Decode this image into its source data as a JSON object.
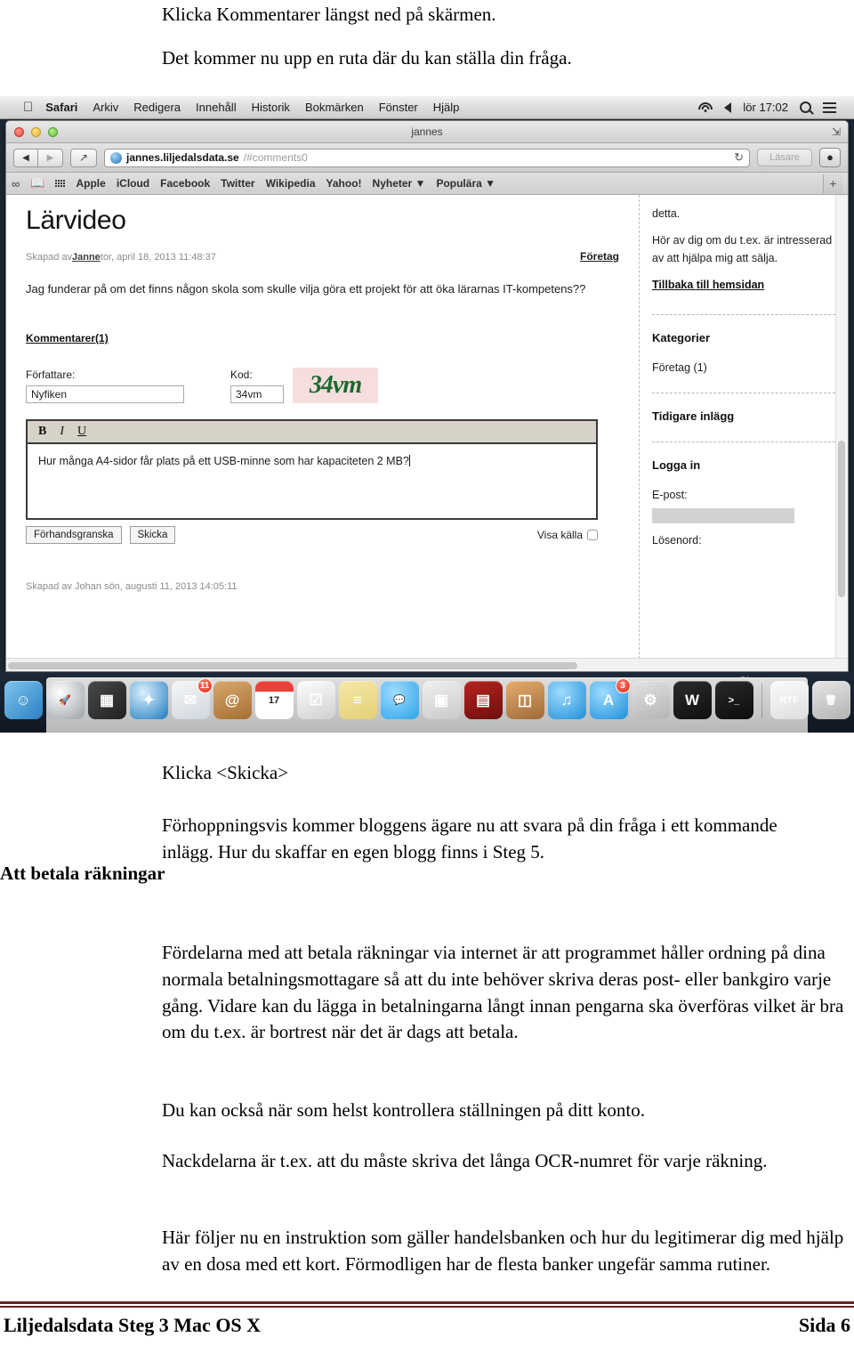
{
  "document": {
    "intro_line_1": "Klicka Kommentarer längst ned på skärmen.",
    "intro_line_2": "Det kommer nu upp en ruta där du kan ställa din fråga.",
    "klicka_skicka": "Klicka <Skicka>",
    "forhoppningsvis": "Förhoppningsvis kommer bloggens ägare nu att svara på din fråga i ett kommande inlägg. Hur du skaffar en egen blogg finns i Steg 5.",
    "heading_att_betala": "Att betala räkningar",
    "fordelarna": "Fördelarna med att betala räkningar via internet är att programmet håller ordning på dina normala betalningsmottagare så att du inte behöver skriva deras post- eller bankgiro varje gång. Vidare kan du lägga in betalningarna långt innan pengarna ska överföras vilket är bra om du t.ex. är bortrest när det är dags att betala.",
    "du_kan_ocksa": "Du kan också när som helst kontrollera ställningen på ditt konto.",
    "nackdelarna": "Nackdelarna är t.ex. att du måste skriva det långa OCR-numret för varje räkning.",
    "har_foljer": "Här följer nu en instruktion som gäller handelsbanken och hur du legitimerar dig med hjälp av en dosa med ett kort. Förmodligen har de flesta banker ungefär samma rutiner.",
    "footer_left": "Liljedalsdata Steg 3 Mac OS X",
    "footer_right": "Sida 6",
    "footer_rule_color": "#6b2020"
  },
  "screenshot": {
    "menubar": {
      "apple_icon": "apple-icon",
      "app_name": "Safari",
      "menus": [
        "Arkiv",
        "Redigera",
        "Innehåll",
        "Historik",
        "Bokmärken",
        "Fönster",
        "Hjälp"
      ],
      "wifi_icon": "wifi-icon",
      "volume_icon": "volume-icon",
      "clock": "lör 17:02",
      "spotlight_icon": "search-icon",
      "notifications_icon": "notification-list-icon"
    },
    "window": {
      "title": "jannes",
      "close_label": "close-button",
      "minimize_label": "minimize-button",
      "zoom_label": "zoom-button",
      "fullscreen_icon": "fullscreen-icon"
    },
    "toolbar": {
      "back": "◀",
      "forward": "▶",
      "share_icon": "share-icon",
      "url_strong": "jannes.liljedalsdata.se",
      "url_dim": "/#comments0",
      "reload_icon": "↻",
      "reader_label": "Läsare",
      "downloads_icon": "downloads-icon"
    },
    "bookmarks": {
      "sidebar_icon": "reading-glasses-icon",
      "book_icon": "book-icon",
      "grid_icon": "top-sites-icon",
      "items": [
        "Apple",
        "iCloud",
        "Facebook",
        "Twitter",
        "Wikipedia",
        "Yahoo!"
      ],
      "menus": [
        "Nyheter",
        "Populära"
      ],
      "new_tab_label": "+"
    },
    "page": {
      "post_title": "Lärvideo",
      "meta_prefix": "Skapad av ",
      "meta_author": "Janne",
      "meta_date": " tor, april 18, 2013 11:48:37",
      "category_link": "Företag",
      "post_body": "Jag funderar på om det finns någon skola som skulle vilja göra ett projekt för att öka lärarnas IT-kompetens??",
      "comments_heading": "Kommentarer(1)",
      "author_label": "Författare:",
      "author_value": "Nyfiken",
      "kod_label": "Kod:",
      "kod_value": "34vm",
      "captcha_text": "34vm",
      "captcha_bg": "#f6dede",
      "captcha_fg": "#1a6b2e",
      "editor_bold": "B",
      "editor_italic": "I",
      "editor_underline": "U",
      "editor_text": "Hur många A4-sidor får plats på ett USB-minne som har kapaciteten 2 MB?",
      "preview_button": "Förhandsgranska",
      "send_button": "Skicka",
      "show_source_label": "Visa källa",
      "last_comment_meta": "Skapad av Johan sön, augusti 11, 2013 14:05:11"
    },
    "sidebar": {
      "text_top": "detta.",
      "text_hor": "Hör av dig om du t.ex. är intresserad av att hjälpa mig att sälja.",
      "back_link": "Tillbaka till hemsidan",
      "categories_heading": "Kategorier",
      "category_item": "Företag (1)",
      "earlier_heading": "Tidigare inlägg",
      "login_heading": "Logga in",
      "email_label": "E-post:",
      "password_label": "Lösenord:"
    },
    "dock": {
      "clapp_label": "Clapp",
      "items": [
        {
          "name": "finder-icon",
          "glyph": "☺",
          "bg": "linear-gradient(135deg,#7fc6f0,#2b7fc1)",
          "badge": ""
        },
        {
          "name": "launchpad-icon",
          "glyph": "🚀",
          "bg": "radial-gradient(circle at 35% 30%,#ffffff,#9aa0a6)",
          "badge": ""
        },
        {
          "name": "mission-control-icon",
          "glyph": "▦",
          "bg": "linear-gradient(135deg,#4a4a4a,#1f1f1f)",
          "badge": ""
        },
        {
          "name": "safari-icon",
          "glyph": "✦",
          "bg": "radial-gradient(circle at 35% 30%,#d9f0ff,#1f7bbd)",
          "badge": ""
        },
        {
          "name": "mail-icon",
          "glyph": "✉",
          "bg": "linear-gradient(160deg,#f6f6f6,#cfd7de)",
          "badge": "11"
        },
        {
          "name": "contacts-icon",
          "glyph": "@",
          "bg": "linear-gradient(160deg,#d9a86a,#a56f33)",
          "badge": ""
        },
        {
          "name": "calendar-icon",
          "glyph": "17",
          "bg": "linear-gradient(180deg,#e8413a 0%,#e8413a 28%,#ffffff 28%)",
          "badge": ""
        },
        {
          "name": "reminders-icon",
          "glyph": "☑",
          "bg": "linear-gradient(160deg,#fdfdfd,#d0d0d0)",
          "badge": ""
        },
        {
          "name": "notes-icon",
          "glyph": "≡",
          "bg": "linear-gradient(160deg,#f6e9a8,#e2cf76)",
          "badge": ""
        },
        {
          "name": "messages-icon",
          "glyph": "💬",
          "bg": "radial-gradient(circle at 35% 30%,#9fdcff,#2aa3e8)",
          "badge": ""
        },
        {
          "name": "facetime-icon",
          "glyph": "▣",
          "bg": "linear-gradient(160deg,#f0f0f0,#c9c9c9)",
          "badge": ""
        },
        {
          "name": "photobooth-icon",
          "glyph": "▤",
          "bg": "linear-gradient(160deg,#b6231f,#6d0f0d)",
          "badge": ""
        },
        {
          "name": "iphoto-icon",
          "glyph": "◫",
          "bg": "linear-gradient(160deg,#e8ac6c,#9c6a38)",
          "badge": ""
        },
        {
          "name": "itunes-icon",
          "glyph": "♫",
          "bg": "radial-gradient(circle at 35% 30%,#9fdcff,#1d8fd8)",
          "badge": ""
        },
        {
          "name": "app-store-icon",
          "glyph": "A",
          "bg": "radial-gradient(circle at 35% 30%,#9fdcff,#1d8fd8)",
          "badge": "3"
        },
        {
          "name": "system-preferences-icon",
          "glyph": "⚙",
          "bg": "linear-gradient(160deg,#e3e3e3,#b4b4b4)",
          "badge": ""
        },
        {
          "name": "warning-app-icon",
          "glyph": "W",
          "bg": "linear-gradient(160deg,#2b2b2b,#101010)",
          "badge": ""
        },
        {
          "name": "terminal-icon",
          "glyph": ">_",
          "bg": "linear-gradient(160deg,#2a2a2a,#0c0c0c)",
          "badge": ""
        }
      ],
      "trailing": [
        {
          "name": "rtf-document-icon",
          "glyph": "RTF",
          "bg": "linear-gradient(160deg,#fbfbfb,#dedede)",
          "badge": ""
        },
        {
          "name": "trash-icon",
          "glyph": "🗑",
          "bg": "linear-gradient(160deg,#e6e6e6,#b3b3b3)",
          "badge": ""
        }
      ]
    }
  }
}
